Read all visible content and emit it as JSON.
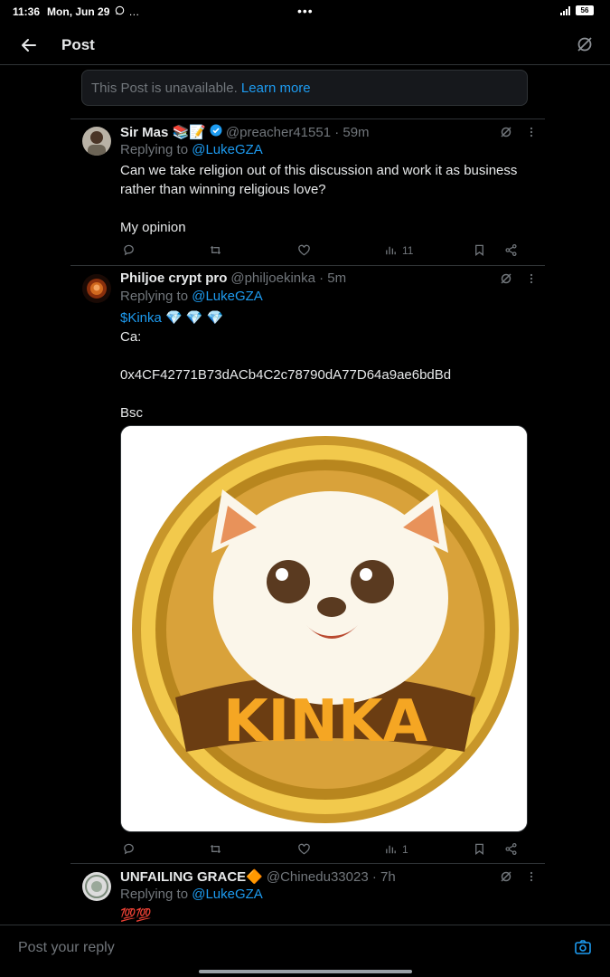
{
  "status": {
    "time": "11:36",
    "date": "Mon, Jun 29",
    "extra": "…",
    "center_dots": "•••",
    "battery": "56"
  },
  "header": {
    "title": "Post"
  },
  "notice": {
    "text": "This Post is unavailable.",
    "link": "Learn more"
  },
  "replies": [
    {
      "name": "Sir Mas 📚📝",
      "verified": true,
      "handle": "@preacher41551 · 59m",
      "replying_prefix": "Replying to ",
      "replying_to": "@LukeGZA",
      "text": "Can we take religion out of this discussion and work it as business rather than winning religious love?\n\nMy opinion",
      "views": "11"
    },
    {
      "name": "Philjoe crypt pro",
      "handle": "@philjoekinka · 5m",
      "replying_prefix": "Replying to ",
      "replying_to": "@LukeGZA",
      "cashtag": "$Kinka",
      "tag_emoji": " 💎 💎 💎",
      "text": "Ca:\n\n0x4CF42771B73dACb4C2c78790dA77D64a9ae6bdBd\n\nBsc",
      "image_text": "KINKA",
      "views": "1"
    },
    {
      "name": "UNFAILING GRACE🔶",
      "handle": "@Chinedu33023 · 7h",
      "replying_prefix": "Replying to ",
      "replying_to": "@LukeGZA",
      "text": "💯💯"
    }
  ],
  "composer": {
    "placeholder": "Post your reply"
  },
  "colors": {
    "accent": "#1d9bf0",
    "muted": "#71767b",
    "text": "#e7e9ea",
    "background": "#000000",
    "divider": "#2f3336"
  }
}
